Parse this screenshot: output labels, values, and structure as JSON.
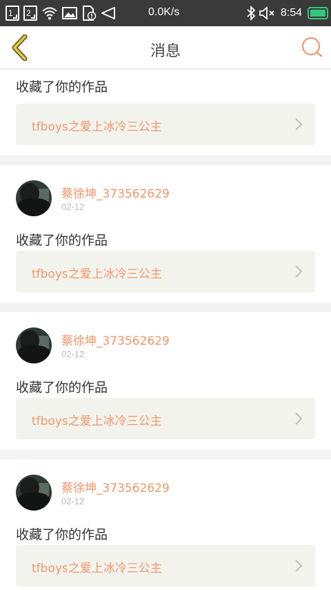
{
  "status_bar": {
    "sim1": "1",
    "sim2": "2",
    "speed": "0.0K/s",
    "time": "8:54",
    "battery_color": "#34c77b"
  },
  "nav": {
    "title": "消息",
    "back_icon": "chevron-left-icon",
    "search_icon": "search-icon",
    "accent": "#ef9668"
  },
  "messages": [
    {
      "action": "收藏了你的作品",
      "work_title": "tfboys之爱上冰冷三公主"
    },
    {
      "username": "蔡徐坤_373562629",
      "date": "02-12",
      "action": "收藏了你的作品",
      "work_title": "tfboys之爱上冰冷三公主"
    },
    {
      "username": "蔡徐坤_373562629",
      "date": "02-12",
      "action": "收藏了你的作品",
      "work_title": "tfboys之爱上冰冷三公主"
    },
    {
      "username": "蔡徐坤_373562629",
      "date": "02-12",
      "action": "收藏了你的作品",
      "work_title": "tfboys之爱上冰冷三公主"
    }
  ]
}
